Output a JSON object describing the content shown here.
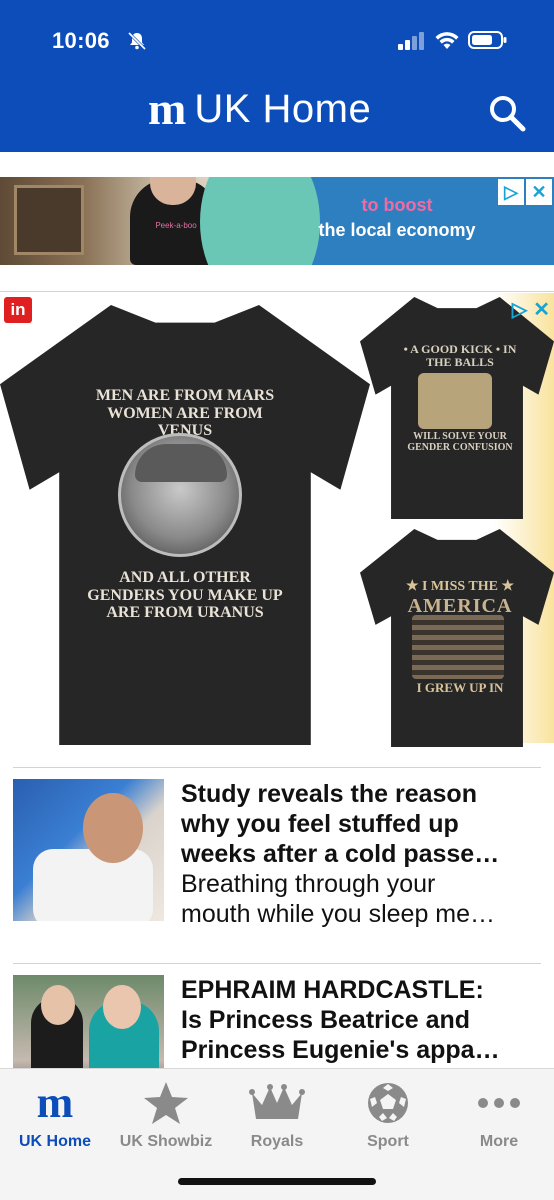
{
  "status_bar": {
    "time": "10:06"
  },
  "header": {
    "logo": "m",
    "title": "UK Home"
  },
  "banner_ad": {
    "line1": "to boost",
    "line2": "the local economy",
    "apron_text": "Peek-a-boo"
  },
  "big_ad": {
    "badge": "in",
    "main_shirt": {
      "top_text": "MEN ARE FROM MARS WOMEN ARE FROM VENUS",
      "bottom_text": "AND ALL OTHER GENDERS YOU MAKE UP ARE FROM URANUS"
    },
    "shirt_2": {
      "top_text": "• A GOOD KICK • IN THE BALLS",
      "bottom_text": "WILL SOLVE YOUR GENDER CONFUSION"
    },
    "shirt_3": {
      "top_text": "★ I MISS THE ★",
      "middle_text": "AMERICA",
      "bottom_text": "I GREW UP IN"
    }
  },
  "articles": [
    {
      "headline_lines": [
        "Study reveals the reason",
        "why you feel stuffed up",
        "weeks after a cold passe…"
      ],
      "summary_lines": [
        "Breathing through your",
        "mouth while you sleep me…"
      ]
    },
    {
      "headline_lines": [
        "EPHRAIM HARDCASTLE:",
        "Is Princess Beatrice and",
        "Princess Eugenie's appa…"
      ],
      "summary_lines": []
    }
  ],
  "tabbar": {
    "tabs": [
      {
        "label": "UK Home",
        "icon": "mail-logo-icon",
        "active": true
      },
      {
        "label": "UK Showbiz",
        "icon": "star-icon",
        "active": false
      },
      {
        "label": "Royals",
        "icon": "crown-icon",
        "active": false
      },
      {
        "label": "Sport",
        "icon": "football-icon",
        "active": false
      },
      {
        "label": "More",
        "icon": "more-dots-icon",
        "active": false
      }
    ]
  },
  "colors": {
    "brand_blue": "#0c4dba",
    "tab_inactive": "#8a8a8a",
    "adchoices_blue": "#18a3d5"
  }
}
